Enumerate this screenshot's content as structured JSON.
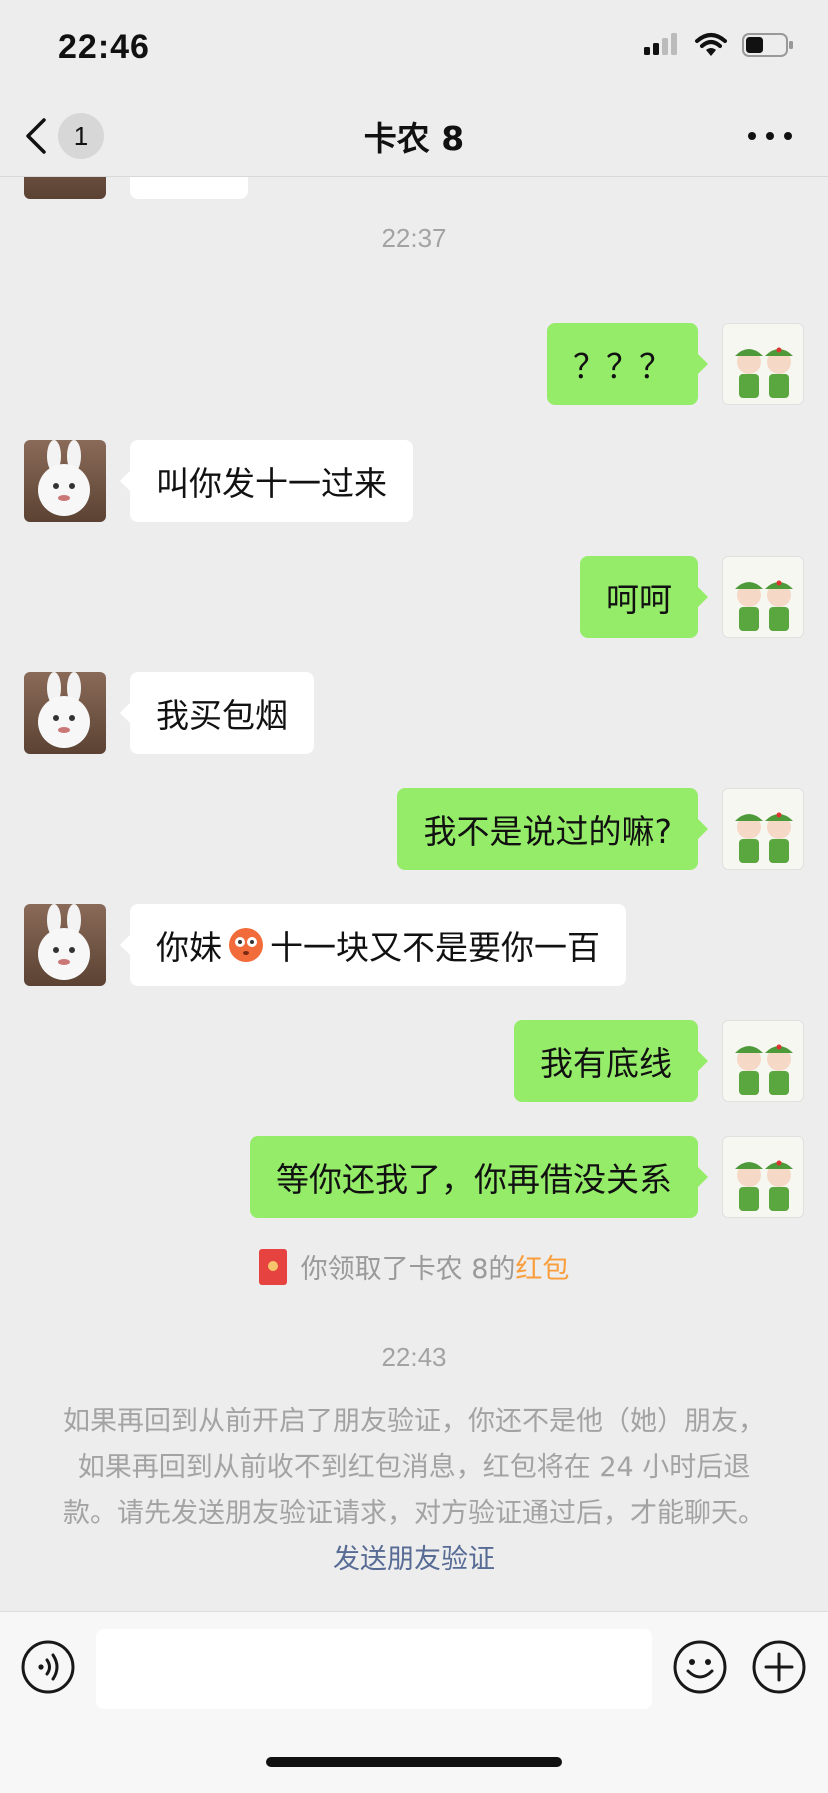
{
  "status_bar": {
    "time": "22:46",
    "battery_level_fraction": 0.45
  },
  "header": {
    "back_count": "1",
    "title": "卡农 8"
  },
  "messages": [
    {
      "timestamp": "22:37"
    },
    {
      "side": "right",
      "text": "？？？"
    },
    {
      "side": "left",
      "text": "叫你发十一过来"
    },
    {
      "side": "right",
      "text": "呵呵"
    },
    {
      "side": "left",
      "text": "我买包烟"
    },
    {
      "side": "right",
      "text": "我不是说过的嘛?"
    },
    {
      "side": "left",
      "text_before": "你妹",
      "emoji": "flushed-face-emoji",
      "text_after": "十一块又不是要你一百"
    },
    {
      "side": "right",
      "text": "我有底线"
    },
    {
      "side": "right",
      "text": "等你还我了，你再借没关系"
    }
  ],
  "red_packet_notice": {
    "text": "你领取了卡农 8的",
    "link": "红包"
  },
  "timestamp_2": "22:43",
  "system_notice": {
    "text": "如果再回到从前开启了朋友验证，你还不是他（她）朋友，如果再回到从前收不到红包消息，红包将在 24 小时后退款。请先发送朋友验证请求，对方验证通过后，才能聊天。",
    "link": "发送朋友验证"
  },
  "input": {
    "value": "",
    "placeholder": ""
  },
  "colors": {
    "background": "#ededed",
    "sent_bubble": "#95ec69",
    "received_bubble": "#ffffff",
    "link_blue": "#576b95",
    "red_packet_orange": "#fa9d3b"
  }
}
